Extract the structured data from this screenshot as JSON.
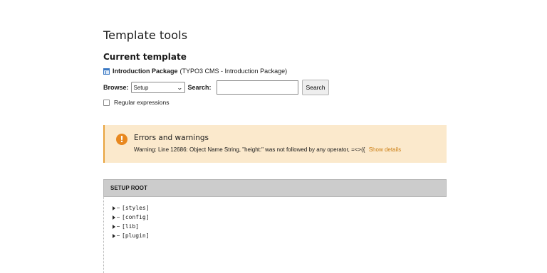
{
  "page": {
    "title": "Template tools",
    "subtitle": "Current template"
  },
  "template": {
    "icon": "template-icon",
    "name": "Introduction Package",
    "detail": "(TYPO3 CMS - Introduction Package)"
  },
  "controls": {
    "browse_label": "Browse:",
    "browse_value": "Setup",
    "search_label": "Search:",
    "search_value": "",
    "search_button": "Search",
    "regex_label": "Regular expressions",
    "regex_checked": false
  },
  "alert": {
    "icon": "exclamation-icon",
    "title": "Errors and warnings",
    "message": "Warning: Line 12686: Object Name String, \"height:\" was not followed by any operator, =<>({",
    "link": "Show details",
    "colors": {
      "background": "#fbe9cc",
      "icon": "#e8881f",
      "link": "#cc7e13"
    }
  },
  "setup": {
    "header": "SETUP ROOT",
    "items": [
      {
        "label": "[styles]"
      },
      {
        "label": "[config]"
      },
      {
        "label": "[lib]"
      },
      {
        "label": "[plugin]"
      }
    ]
  }
}
